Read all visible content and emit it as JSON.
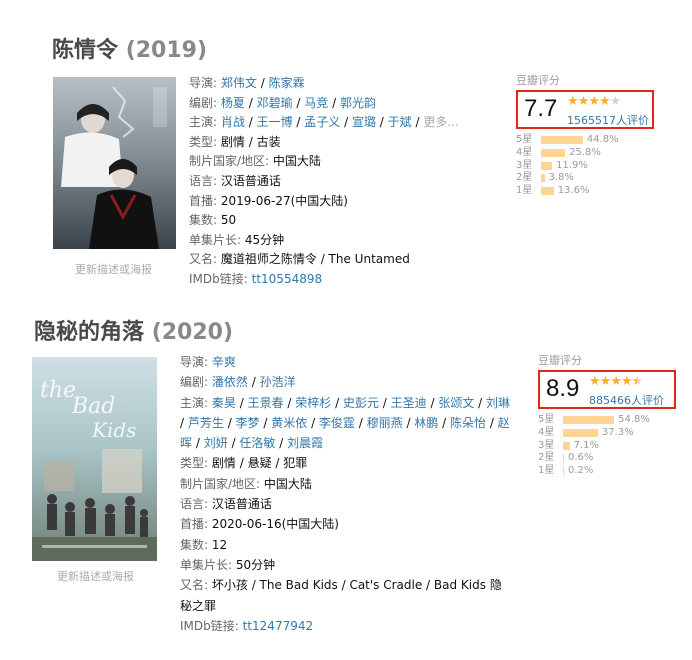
{
  "colors": {
    "link": "#3377aa",
    "star": "#ffac2d",
    "bar": "#ffd596",
    "highlight_box": "#e1261c"
  },
  "movies": [
    {
      "title": "陈情令",
      "year": "(2019)",
      "update_link": "更新描述或海报",
      "info": {
        "director_label": "导演:",
        "directors": [
          "郑伟文",
          "陈家霖"
        ],
        "writer_label": "编剧:",
        "writers": [
          "杨夏",
          "邓碧瑜",
          "马竞",
          "郭光韵"
        ],
        "cast_label": "主演:",
        "cast": [
          "肖战",
          "王一博",
          "孟子义",
          "宣璐",
          "于斌"
        ],
        "more": "更多...",
        "genre_label": "类型:",
        "genres": [
          "剧情",
          "古装"
        ],
        "country_label": "制片国家/地区:",
        "country": "中国大陆",
        "language_label": "语言:",
        "language": "汉语普通话",
        "release_label": "首播:",
        "release": "2019-06-27(中国大陆)",
        "episodes_label": "集数:",
        "episodes": "50",
        "runtime_label": "单集片长:",
        "runtime": "45分钟",
        "aka_label": "又名:",
        "aka": "魔道祖师之陈情令 / The Untamed",
        "imdb_label": "IMDb链接:",
        "imdb": "tt10554898"
      },
      "rating": {
        "label": "豆瓣评分",
        "score": "7.7",
        "stars_filled": 4,
        "stars_half": 0,
        "votes": "1565517人评价",
        "distribution": [
          {
            "label": "5星",
            "pct": "44.8%",
            "value": 44.8
          },
          {
            "label": "4星",
            "pct": "25.8%",
            "value": 25.8
          },
          {
            "label": "3星",
            "pct": "11.9%",
            "value": 11.9
          },
          {
            "label": "2星",
            "pct": "3.8%",
            "value": 3.8
          },
          {
            "label": "1星",
            "pct": "13.6%",
            "value": 13.6
          }
        ]
      }
    },
    {
      "title": "隐秘的角落",
      "year": "(2020)",
      "update_link": "更新描述或海报",
      "info": {
        "director_label": "导演:",
        "directors": [
          "辛爽"
        ],
        "writer_label": "编剧:",
        "writers": [
          "潘依然",
          "孙浩洋"
        ],
        "cast_label": "主演:",
        "cast": [
          "秦昊",
          "王景春",
          "荣梓杉",
          "史彭元",
          "王圣迪",
          "张颂文",
          "刘琳",
          "芦芳生",
          "李梦",
          "黄米依",
          "李俊霆",
          "穆丽燕",
          "林鹏",
          "陈朵怡",
          "赵晖",
          "刘妍",
          "任洛敏",
          "刘晨霞"
        ],
        "genre_label": "类型:",
        "genres": [
          "剧情",
          "悬疑",
          "犯罪"
        ],
        "country_label": "制片国家/地区:",
        "country": "中国大陆",
        "language_label": "语言:",
        "language": "汉语普通话",
        "release_label": "首播:",
        "release": "2020-06-16(中国大陆)",
        "episodes_label": "集数:",
        "episodes": "12",
        "runtime_label": "单集片长:",
        "runtime": "50分钟",
        "aka_label": "又名:",
        "aka_line1": "坏小孩 / The Bad Kids / Cat's Cradle / Bad Kids 隐",
        "aka_line2": "秘之罪",
        "imdb_label": "IMDb链接:",
        "imdb": "tt12477942"
      },
      "rating": {
        "label": "豆瓣评分",
        "score": "8.9",
        "stars_filled": 4,
        "stars_half": 1,
        "votes": "885466人评价",
        "distribution": [
          {
            "label": "5星",
            "pct": "54.8%",
            "value": 54.8
          },
          {
            "label": "4星",
            "pct": "37.3%",
            "value": 37.3
          },
          {
            "label": "3星",
            "pct": "7.1%",
            "value": 7.1
          },
          {
            "label": "2星",
            "pct": "0.6%",
            "value": 0.6
          },
          {
            "label": "1星",
            "pct": "0.2%",
            "value": 0.2
          }
        ]
      }
    }
  ]
}
